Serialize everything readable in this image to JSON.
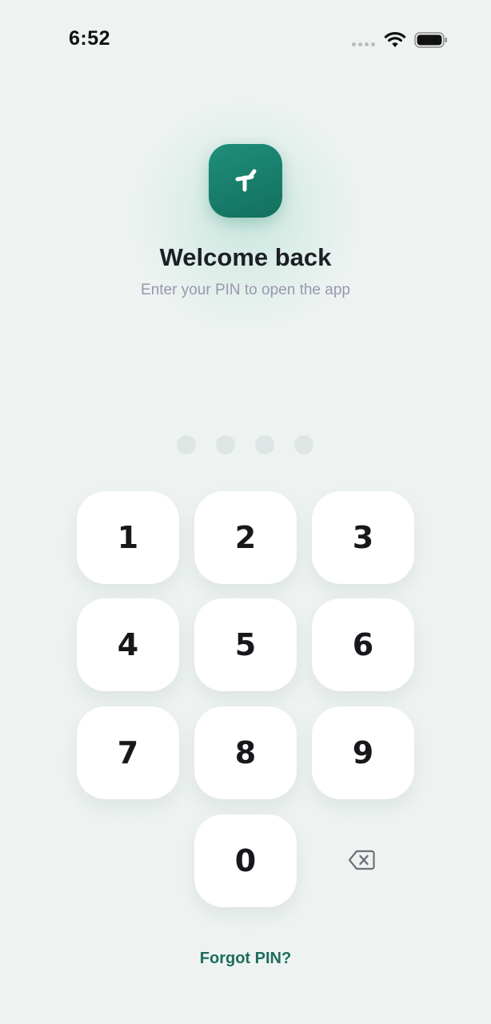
{
  "status_bar": {
    "time": "6:52",
    "signal_icon": "signal-dots-icon",
    "wifi_icon": "wifi-icon",
    "battery_icon": "battery-icon"
  },
  "header": {
    "logo_icon": "app-logo-icon",
    "title": "Welcome back",
    "subtitle": "Enter your PIN to open the app"
  },
  "pin": {
    "length": 4,
    "entered": 0
  },
  "keypad": {
    "keys": [
      "1",
      "2",
      "3",
      "4",
      "5",
      "6",
      "7",
      "8",
      "9",
      "0"
    ],
    "backspace_icon": "backspace-icon"
  },
  "footer": {
    "forgot_label": "Forgot PIN?"
  },
  "colors": {
    "background": "#eef3f2",
    "accent": "#1f6c5c",
    "logo": "#1a8270",
    "subtitle": "#9a97ae"
  }
}
